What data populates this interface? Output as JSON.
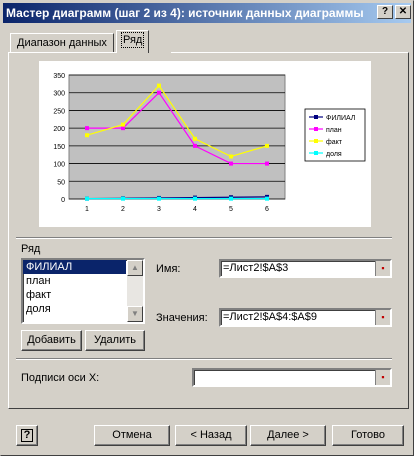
{
  "window": {
    "title": "Мастер диаграмм (шаг 2 из 4): источник данных диаграммы",
    "help_btn": "?",
    "close_btn": "✕"
  },
  "tabs": [
    {
      "label": "Диапазон данных"
    },
    {
      "label": "Ряд"
    }
  ],
  "chart_data": {
    "type": "line",
    "categories": [
      "1",
      "2",
      "3",
      "4",
      "5",
      "6"
    ],
    "ylim": [
      0,
      350
    ],
    "yticks": [
      "0",
      "50",
      "100",
      "150",
      "200",
      "250",
      "300",
      "350"
    ],
    "grid": true,
    "legend": "right",
    "series": [
      {
        "name": "ФИЛИАЛ",
        "color": "#000080",
        "values": [
          1,
          2,
          3,
          4,
          5,
          6
        ]
      },
      {
        "name": "план",
        "color": "#ff00ff",
        "values": [
          200,
          200,
          300,
          150,
          100,
          100
        ]
      },
      {
        "name": "факт",
        "color": "#ffff00",
        "values": [
          180,
          210,
          320,
          170,
          120,
          150
        ]
      },
      {
        "name": "доля",
        "color": "#00ffff",
        "values": [
          1,
          1,
          1,
          1,
          1,
          1
        ]
      }
    ]
  },
  "series_section": {
    "label": "Ряд",
    "items": [
      "ФИЛИАЛ",
      "план",
      "факт",
      "доля"
    ],
    "selected_index": 0,
    "add_button": "Добавить",
    "remove_button": "Удалить"
  },
  "name_field": {
    "label": "Имя:",
    "value": "=Лист2!$A$3"
  },
  "values_field": {
    "label": "Значения:",
    "value": "=Лист2!$A$4:$A$9"
  },
  "xaxis_field": {
    "label": "Подписи оси X:",
    "value": ""
  },
  "footer": {
    "help": "?",
    "cancel": "Отмена",
    "back": "< Назад",
    "next": "Далее >",
    "finish": "Готово"
  }
}
